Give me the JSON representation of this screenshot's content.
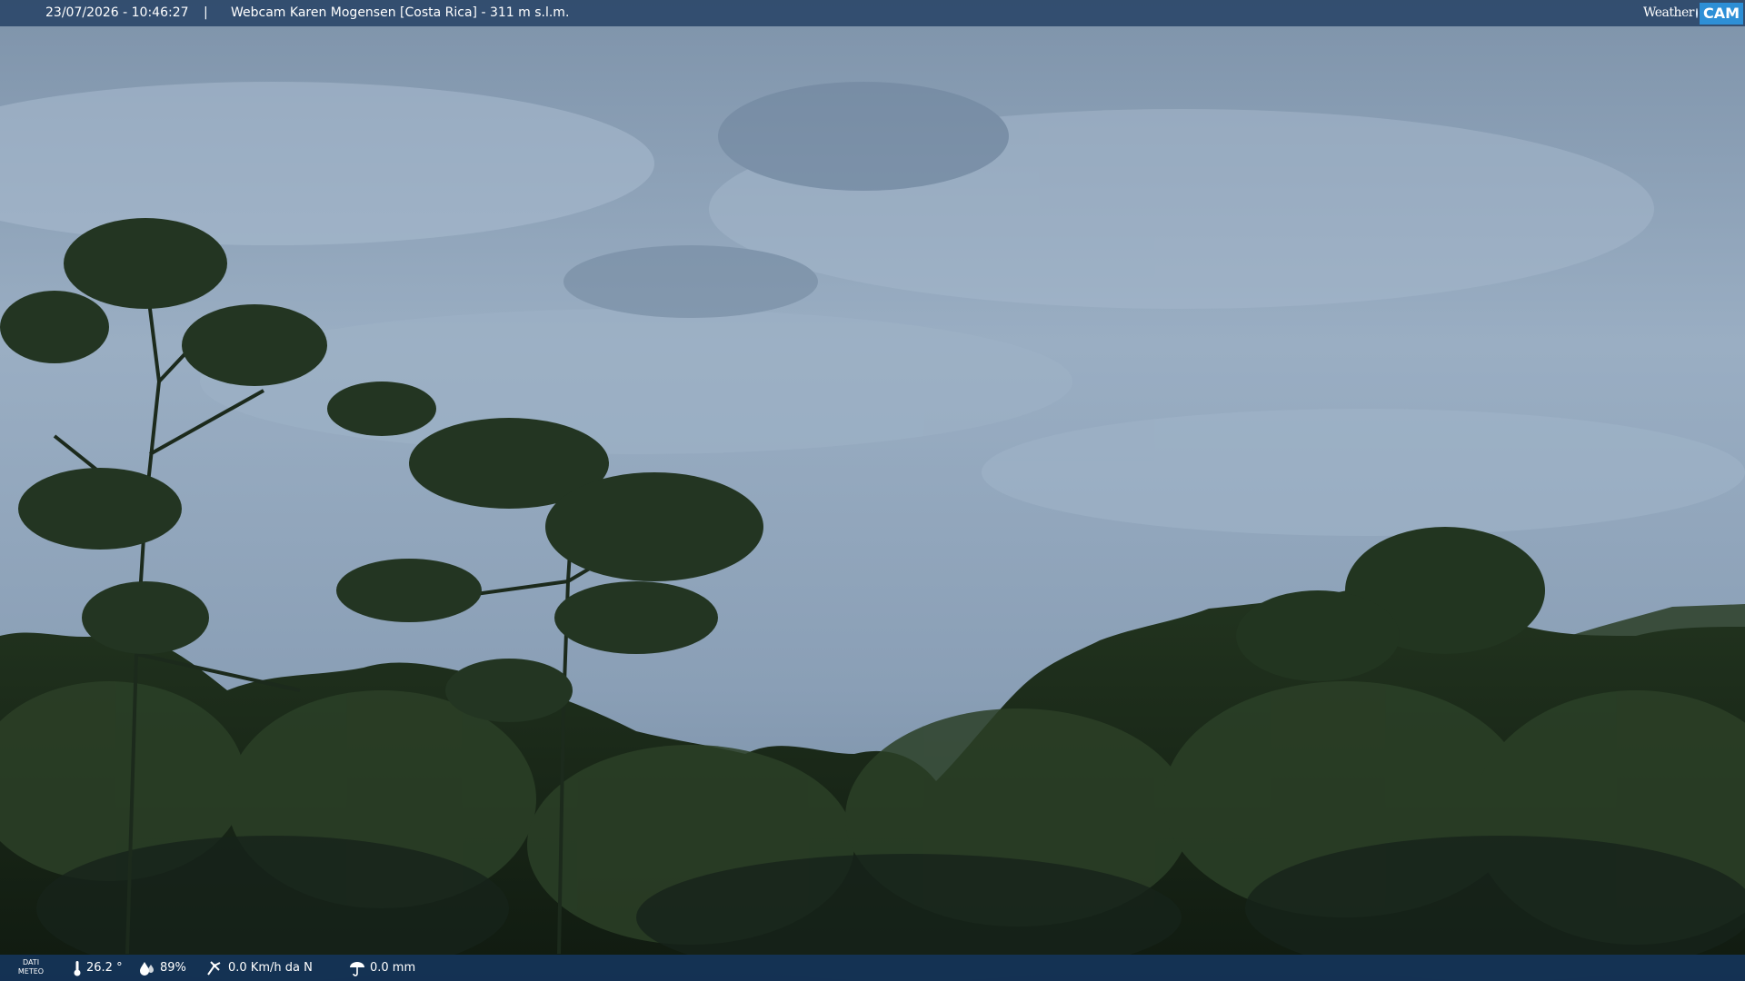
{
  "header": {
    "datetime": "23/07/2026 - 10:46:27",
    "separator": "|",
    "caption": "Webcam Karen Mogensen [Costa Rica] - 311 m s.l.m.",
    "logo": {
      "word": "Weather",
      "badge": "CAM",
      "icon": "weathercam-logo-icon"
    }
  },
  "meteo": {
    "label_line1": "DATI",
    "label_line2": "METEO",
    "temperature": "26.2 °",
    "humidity": "89%",
    "wind": "0.0 Km/h da N",
    "rain": "0.0 mm",
    "icons": [
      "thermometer-icon",
      "humidity-icon",
      "wind-icon",
      "rain-icon"
    ]
  },
  "colors": {
    "sky": "#8da2b8",
    "forest": "#1d2d1c",
    "header_bar": "#2d486a",
    "footer_bar": "#143458",
    "logo_accent": "#2d8fd6"
  }
}
